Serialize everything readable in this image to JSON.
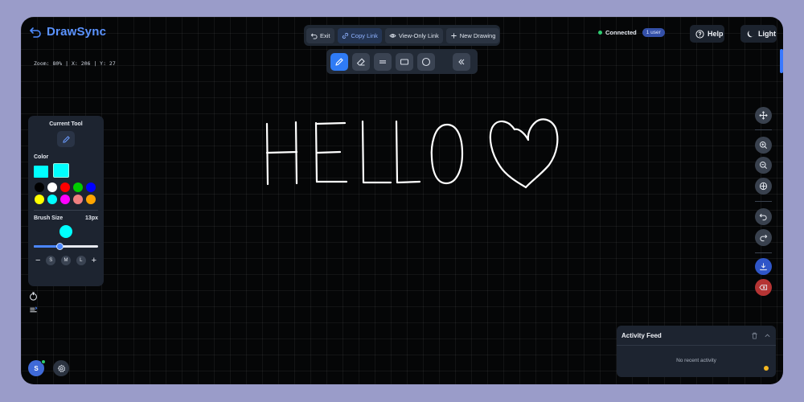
{
  "app": {
    "name": "DrawSync"
  },
  "topbar": {
    "exit": "Exit",
    "copy_link": "Copy Link",
    "view_only": "View-Only Link",
    "new_drawing": "New Drawing"
  },
  "status": {
    "text": "Connected",
    "users": "1 user",
    "color": "#2ecc71"
  },
  "header": {
    "help": "Help",
    "theme": "Light"
  },
  "coords": {
    "text": "Zoom: 80% | X: 206 | Y: 27"
  },
  "toolbar": {
    "tools": [
      "pencil-icon",
      "eraser-icon",
      "line-icon",
      "rectangle-icon",
      "circle-icon",
      "collapse-icon"
    ],
    "active": "pencil"
  },
  "panel": {
    "title": "Current Tool",
    "color_label": "Color",
    "current_color": "#00ffff",
    "palette": [
      "#000000",
      "#ffffff",
      "#ff0000",
      "#00cc00",
      "#0000ff",
      "#ffff00",
      "#00ffff",
      "#ff00ff",
      "#f08080",
      "#ffa500"
    ],
    "brush_label": "Brush Size",
    "brush_size": "13px",
    "brush_fraction": 0.4,
    "sizes": [
      "S",
      "M",
      "L"
    ],
    "minus": "−",
    "plus": "+"
  },
  "user": {
    "initial": "S"
  },
  "right_tools": [
    "move-icon",
    "zoom-in-icon",
    "zoom-out-icon",
    "reset-view-icon",
    "undo-icon",
    "redo-icon",
    "download-icon",
    "clear-canvas-icon"
  ],
  "activity": {
    "title": "Activity Feed",
    "empty": "No recent activity"
  },
  "canvas": {
    "drawing_text": "HELLO",
    "stroke_color": "#ffffff"
  }
}
